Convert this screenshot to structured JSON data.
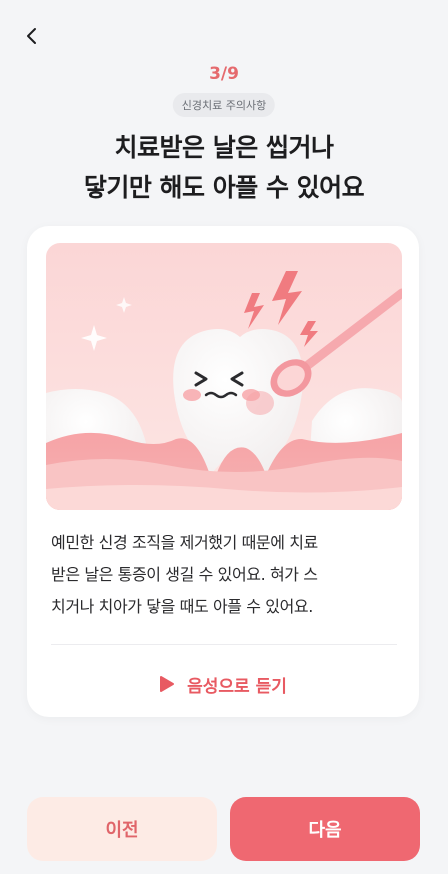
{
  "header": {
    "back_icon": "chevron-left-icon",
    "progress": "3/9",
    "category": "신경치료 주의사항"
  },
  "title": {
    "line1": "치료받은 날은 씹거나",
    "line2": "닿기만 해도 아플 수 있어요"
  },
  "card": {
    "illustration": "tooth-pain-illustration",
    "description": [
      "예민한 신경 조직을 제거했기 때문에 치료",
      "받은 날은 통증이 생길 수 있어요. 혀가 스",
      "치거나 치아가 닿을 때도 아플 수 있어요."
    ],
    "listen_icon": "play-icon",
    "listen_label": "음성으로 듣기"
  },
  "footer": {
    "prev_label": "이전",
    "next_label": "다음"
  },
  "colors": {
    "accent": "#e85a62",
    "primary_button": "#ef6871",
    "secondary_button": "#fdebe5",
    "background": "#f4f5f7"
  }
}
